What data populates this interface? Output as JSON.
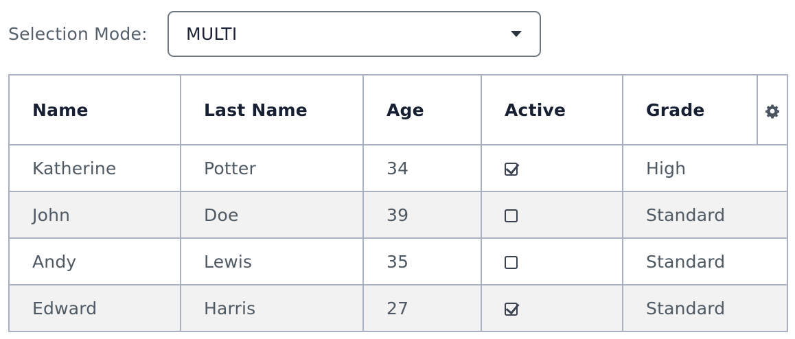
{
  "selection_mode": {
    "label": "Selection Mode:",
    "value": "MULTI"
  },
  "table": {
    "columns": [
      "Name",
      "Last Name",
      "Age",
      "Active",
      "Grade"
    ],
    "settings_icon": "gear-icon",
    "rows": [
      {
        "name": "Katherine",
        "last_name": "Potter",
        "age": "34",
        "active": true,
        "grade": "High"
      },
      {
        "name": "John",
        "last_name": "Doe",
        "age": "39",
        "active": false,
        "grade": "Standard"
      },
      {
        "name": "Andy",
        "last_name": "Lewis",
        "age": "35",
        "active": false,
        "grade": "Standard"
      },
      {
        "name": "Edward",
        "last_name": "Harris",
        "age": "27",
        "active": true,
        "grade": "Standard"
      }
    ]
  },
  "colors": {
    "border": "#a9b0c0",
    "header_text": "#172033",
    "stripe": "#f2f2f2"
  }
}
